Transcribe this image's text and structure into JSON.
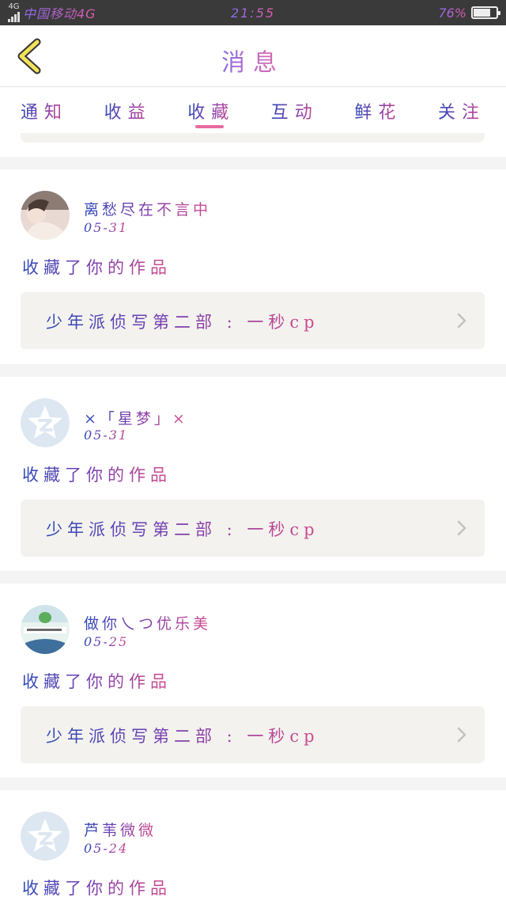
{
  "status_bar": {
    "network_type": "4G",
    "carrier": "中国移动4G",
    "time": "21:55",
    "battery_percent": "76%",
    "battery_level": 0.76
  },
  "nav": {
    "back_icon": "chevron-left-icon",
    "title": "消息"
  },
  "tabs": [
    {
      "label": "通知",
      "active": false
    },
    {
      "label": "收益",
      "active": false
    },
    {
      "label": "收藏",
      "active": true
    },
    {
      "label": "互动",
      "active": false
    },
    {
      "label": "鲜花",
      "active": false
    },
    {
      "label": "关注",
      "active": false
    }
  ],
  "messages": [
    {
      "username": "离愁尽在不言中",
      "date": "05-31",
      "action": "收藏了你的作品",
      "work_title": "少年派侦写第二部 : 一秒cp",
      "avatar": "photo-avatar"
    },
    {
      "username": "×「星梦」×",
      "date": "05-31",
      "action": "收藏了你的作品",
      "work_title": "少年派侦写第二部 : 一秒cp",
      "avatar": "default-qzone-avatar"
    },
    {
      "username": "做你乀つ优乐美",
      "date": "05-25",
      "action": "收藏了你的作品",
      "work_title": "少年派侦写第二部 : 一秒cp",
      "avatar": "image-avatar"
    },
    {
      "username": "芦苇微微",
      "date": "05-24",
      "action": "收藏了你的作品",
      "work_title": "",
      "avatar": "default-qzone-avatar"
    }
  ],
  "colors": {
    "accent_pink": "#e86aa0",
    "text_gradient_start": "#2c49b8",
    "text_gradient_end": "#d24a8c",
    "card_bg": "#ffffff",
    "work_box_bg": "#f3f2ee",
    "page_bg": "#f4f4f4"
  }
}
